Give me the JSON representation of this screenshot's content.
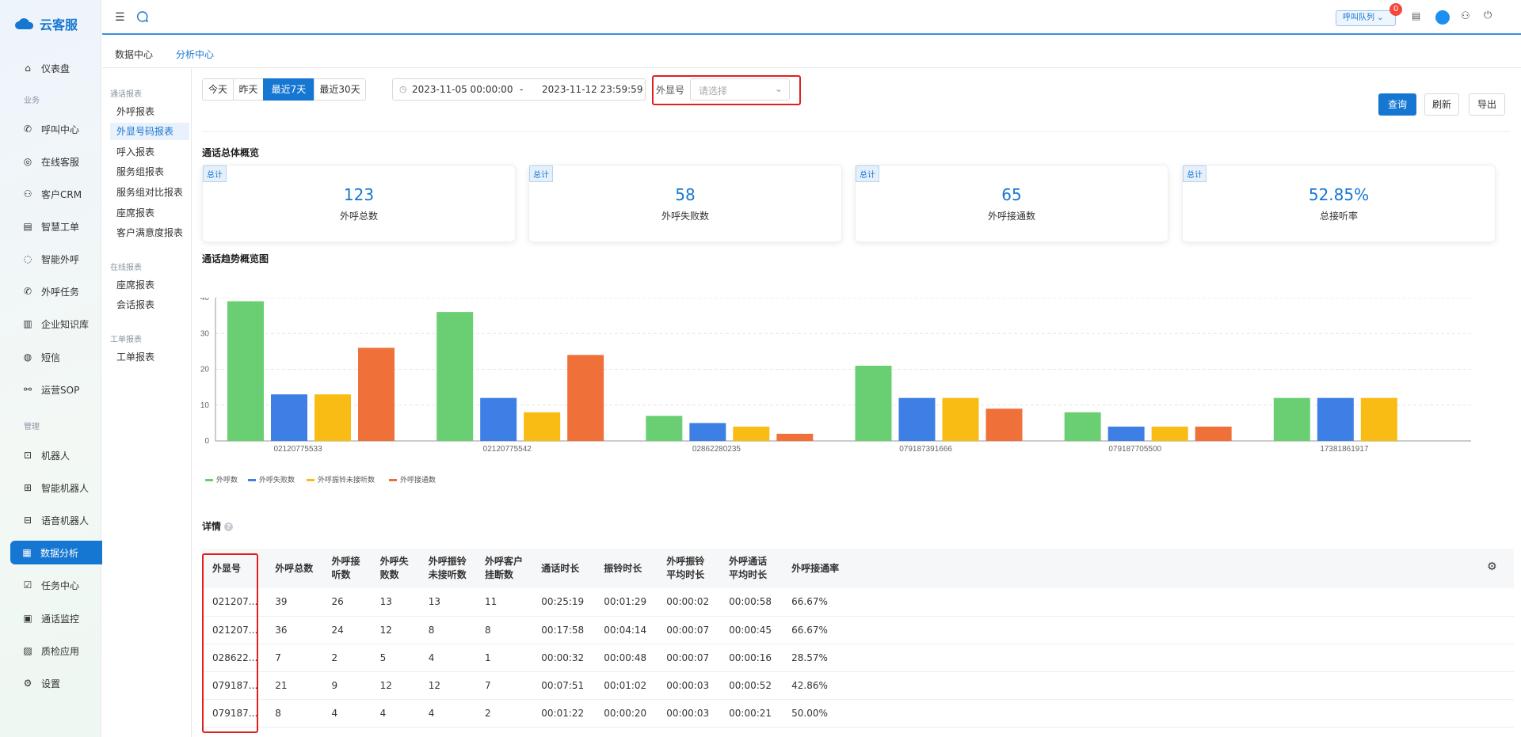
{
  "app": {
    "title": "云客服"
  },
  "sidebar": {
    "groups": [
      "业务",
      "管理"
    ],
    "items": [
      {
        "label": "仪表盘",
        "icon": "home-icon"
      },
      {
        "label": "呼叫中心",
        "icon": "phone-icon"
      },
      {
        "label": "在线客服",
        "icon": "headset-icon"
      },
      {
        "label": "客户CRM",
        "icon": "user-icon"
      },
      {
        "label": "智慧工单",
        "icon": "document-icon"
      },
      {
        "label": "智能外呼",
        "icon": "whatsapp-icon"
      },
      {
        "label": "外呼任务",
        "icon": "phone-forward-icon"
      },
      {
        "label": "企业知识库",
        "icon": "book-icon"
      },
      {
        "label": "短信",
        "icon": "message-icon"
      },
      {
        "label": "运营SOP",
        "icon": "share-icon"
      },
      {
        "label": "机器人",
        "icon": "robot-icon"
      },
      {
        "label": "智能机器人",
        "icon": "smart-robot-icon"
      },
      {
        "label": "语音机器人",
        "icon": "voice-robot-icon"
      },
      {
        "label": "数据分析",
        "icon": "bar-chart-icon"
      },
      {
        "label": "任务中心",
        "icon": "task-icon"
      },
      {
        "label": "通话监控",
        "icon": "monitor-icon"
      },
      {
        "label": "质检应用",
        "icon": "inspect-icon"
      },
      {
        "label": "设置",
        "icon": "settings-icon"
      }
    ]
  },
  "topbar": {
    "queue_label": "呼叫队列",
    "badge": "0"
  },
  "tabs": [
    "数据中心",
    "分析中心"
  ],
  "subnav": {
    "group1": "通话报表",
    "group1_items": [
      "外呼报表",
      "外显号码报表",
      "呼入报表",
      "服务组报表",
      "服务组对比报表",
      "座席报表",
      "客户满意度报表"
    ],
    "group2": "在线报表",
    "group2_items": [
      "座席报表",
      "会话报表"
    ],
    "group3": "工单报表",
    "group3_items": [
      "工单报表"
    ]
  },
  "filters": {
    "ranges": [
      "今天",
      "昨天",
      "最近7天",
      "最近30天"
    ],
    "start": "2023-11-05 00:00:00",
    "sep": "-",
    "end": "2023-11-12 23:59:59",
    "caller_label": "外显号",
    "caller_placeholder": "请选择",
    "query": "查询",
    "refresh": "刷新",
    "export": "导出"
  },
  "overview": {
    "title": "通话总体概览",
    "tag": "总计",
    "cards": [
      {
        "value": "123",
        "label": "外呼总数"
      },
      {
        "value": "58",
        "label": "外呼失败数"
      },
      {
        "value": "65",
        "label": "外呼接通数"
      },
      {
        "value": "52.85%",
        "label": "总接听率"
      }
    ]
  },
  "chart_title": "通话趋势概览图",
  "chart_data": {
    "type": "bar",
    "categories": [
      "02120775533",
      "02120775542",
      "02862280235",
      "079187391666",
      "079187705500",
      "17381861917"
    ],
    "series": [
      {
        "name": "外呼数",
        "color": "#6acf72",
        "values": [
          39,
          36,
          7,
          21,
          8,
          12
        ]
      },
      {
        "name": "外呼失败数",
        "color": "#3e7fe6",
        "values": [
          13,
          12,
          5,
          12,
          4,
          12
        ]
      },
      {
        "name": "外呼振铃未接听数",
        "color": "#f9bc15",
        "values": [
          13,
          8,
          4,
          12,
          4,
          12
        ]
      },
      {
        "name": "外呼接通数",
        "color": "#f0703a",
        "values": [
          26,
          24,
          2,
          9,
          4,
          0
        ]
      }
    ],
    "ylim": [
      0,
      40
    ],
    "yticks": [
      "0",
      "10",
      "20",
      "30",
      "40"
    ],
    "grid": true,
    "legend": "bottom-left"
  },
  "details": {
    "title": "详情",
    "columns": [
      [
        "外显号"
      ],
      [
        "外呼总数"
      ],
      [
        "外呼接",
        "听数"
      ],
      [
        "外呼失",
        "败数"
      ],
      [
        "外呼振铃",
        "未接听数"
      ],
      [
        "外呼客户",
        "挂断数"
      ],
      [
        "通话时长"
      ],
      [
        "振铃时长"
      ],
      [
        "外呼振铃",
        "平均时长"
      ],
      [
        "外呼通话",
        "平均时长"
      ],
      [
        "外呼接通率"
      ]
    ],
    "rows": [
      [
        "021207...",
        "39",
        "26",
        "13",
        "13",
        "11",
        "00:25:19",
        "00:01:29",
        "00:00:02",
        "00:00:58",
        "66.67%"
      ],
      [
        "021207...",
        "36",
        "24",
        "12",
        "8",
        "8",
        "00:17:58",
        "00:04:14",
        "00:00:07",
        "00:00:45",
        "66.67%"
      ],
      [
        "028622...",
        "7",
        "2",
        "5",
        "4",
        "1",
        "00:00:32",
        "00:00:48",
        "00:00:07",
        "00:00:16",
        "28.57%"
      ],
      [
        "079187...",
        "21",
        "9",
        "12",
        "12",
        "7",
        "00:07:51",
        "00:01:02",
        "00:00:03",
        "00:00:52",
        "42.86%"
      ],
      [
        "079187...",
        "8",
        "4",
        "4",
        "4",
        "2",
        "00:01:22",
        "00:00:20",
        "00:00:03",
        "00:00:21",
        "50.00%"
      ]
    ]
  }
}
